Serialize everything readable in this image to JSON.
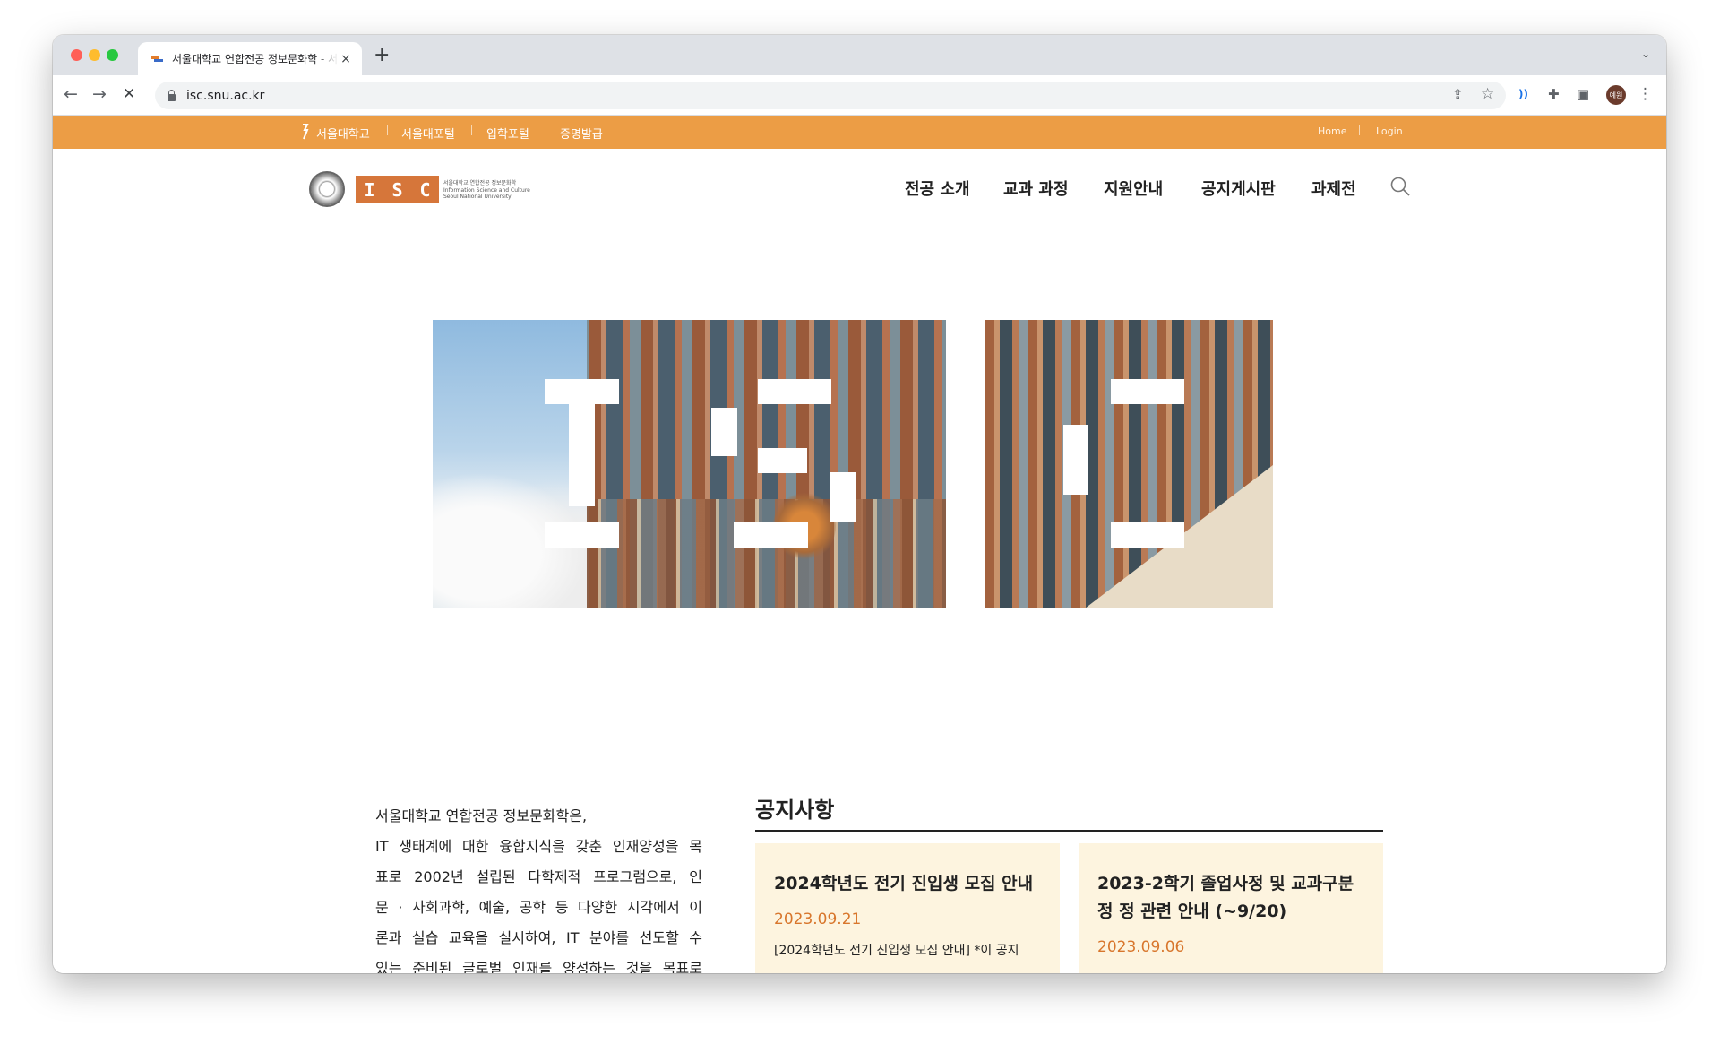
{
  "browser": {
    "tab_title": "서울대학교 연합전공 정보문화학 - 서",
    "tab_close": "×",
    "new_tab": "+",
    "tab_menu": "⌄",
    "url": "isc.snu.ac.kr",
    "icons": {
      "back": "←",
      "forward": "→",
      "stop": "✕",
      "share": "⇪",
      "star": "☆",
      "cast": "))",
      "extensions": "✚",
      "sidepanel": "▣",
      "menu": "⋮"
    },
    "profile_label": "예원"
  },
  "topbar": {
    "links": [
      "서울대학교",
      "서울대포털",
      "입학포털",
      "증명발급"
    ],
    "right": [
      "Home",
      "Login"
    ]
  },
  "logo": {
    "letters": [
      "I",
      "S",
      "C"
    ],
    "sub_lines": [
      "서울대학교 연합전공 정보문화학",
      "Information Science and Culture",
      "Seoul National University"
    ]
  },
  "nav": {
    "items": [
      "전공 소개",
      "교과 과정",
      "지원안내",
      "공지게시판",
      "과제전"
    ]
  },
  "intro": {
    "lines": [
      "서울대학교 연합전공 정보문화학은,",
      "IT 생태계에 대한 융합지식을 갖춘 인재양성을 목",
      "표로 2002년 설립된 다학제적 프로그램으로, 인",
      "문 · 사회과학, 예술, 공학 등 다양한 시각에서 이",
      "론과 실습 교육을 실시하여, IT 분야를 선도할 수",
      "있는 준비된 글로벌 인재를 양성하는 것을 목표로"
    ]
  },
  "notices": {
    "heading": "공지사항",
    "cards": [
      {
        "title": "2024학년도 전기 진입생 모집 안내",
        "date": "2023.09.21",
        "body": "[2024학년도 전기 진입생 모집 안내] *이 공지"
      },
      {
        "title": "2023-2학기 졸업사정 및 교과구분정 정 관련 안내 (~9/20)",
        "date": "2023.09.06",
        "body": ""
      }
    ]
  },
  "colors": {
    "topbar": "#ec9d45",
    "accent": "#d6763a",
    "card_bg": "#fdf4df",
    "date": "#d8762c"
  }
}
